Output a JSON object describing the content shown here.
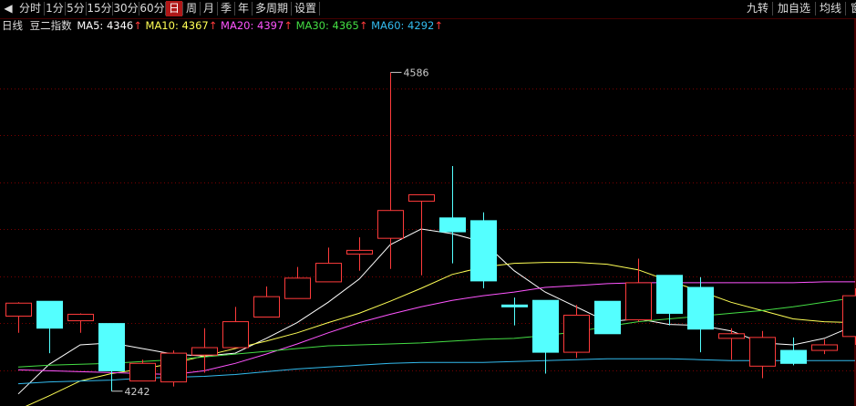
{
  "toolbar": {
    "left_items": [
      {
        "label": "分时",
        "active": false
      },
      {
        "label": "1分",
        "active": false
      },
      {
        "label": "5分",
        "active": false
      },
      {
        "label": "15分",
        "active": false
      },
      {
        "label": "30分",
        "active": false
      },
      {
        "label": "60分",
        "active": false
      },
      {
        "label": "日",
        "active": true
      },
      {
        "label": "周",
        "active": false
      },
      {
        "label": "月",
        "active": false
      },
      {
        "label": "季",
        "active": false
      },
      {
        "label": "年",
        "active": false
      },
      {
        "label": "多周期",
        "active": false
      },
      {
        "label": "设置",
        "active": false
      }
    ],
    "right_items": [
      "九转",
      "加自选",
      "均线",
      "窗"
    ]
  },
  "info": {
    "period": "日线",
    "name": "豆二指数",
    "ma5_label": "MA5: 4346",
    "ma10_label": "MA10: 4367",
    "ma20_label": "MA20: 4397",
    "ma30_label": "MA30: 4365",
    "ma60_label": "MA60: 4292",
    "arrow": "↑"
  },
  "colors": {
    "background": "#000000",
    "up": "#ff3b3b",
    "down": "#54ffff",
    "ma5": "#ffffff",
    "ma10": "#ffff55",
    "ma20": "#ff55ff",
    "ma30": "#44dd44",
    "ma60": "#33bbee",
    "grid": "#7a0000",
    "arrow": "#ff3b3b"
  },
  "chart_data": {
    "type": "candlestick",
    "title": "豆二指数",
    "price_range": [
      4226,
      4610
    ],
    "max_label": "4586",
    "min_label": "4242",
    "candles": [
      {
        "o": 4323,
        "h": 4338,
        "l": 4305,
        "c": 4337
      },
      {
        "o": 4339,
        "h": 4339,
        "l": 4283,
        "c": 4310
      },
      {
        "o": 4318,
        "h": 4326,
        "l": 4305,
        "c": 4325
      },
      {
        "o": 4315,
        "h": 4315,
        "l": 4242,
        "c": 4264
      },
      {
        "o": 4253,
        "h": 4276,
        "l": 4253,
        "c": 4272
      },
      {
        "o": 4252,
        "h": 4286,
        "l": 4247,
        "c": 4283
      },
      {
        "o": 4281,
        "h": 4310,
        "l": 4262,
        "c": 4289
      },
      {
        "o": 4289,
        "h": 4333,
        "l": 4289,
        "c": 4317
      },
      {
        "o": 4322,
        "h": 4355,
        "l": 4322,
        "c": 4344
      },
      {
        "o": 4342,
        "h": 4376,
        "l": 4342,
        "c": 4364
      },
      {
        "o": 4360,
        "h": 4397,
        "l": 4360,
        "c": 4380
      },
      {
        "o": 4390,
        "h": 4408,
        "l": 4372,
        "c": 4394
      },
      {
        "o": 4407,
        "h": 4586,
        "l": 4374,
        "c": 4437
      },
      {
        "o": 4447,
        "h": 4447,
        "l": 4367,
        "c": 4454
      },
      {
        "o": 4429,
        "h": 4485,
        "l": 4380,
        "c": 4414
      },
      {
        "o": 4426,
        "h": 4435,
        "l": 4353,
        "c": 4361
      },
      {
        "o": 4335,
        "h": 4343,
        "l": 4313,
        "c": 4333
      },
      {
        "o": 4340,
        "h": 4340,
        "l": 4261,
        "c": 4284
      },
      {
        "o": 4284,
        "h": 4335,
        "l": 4278,
        "c": 4324
      },
      {
        "o": 4339,
        "h": 4339,
        "l": 4304,
        "c": 4304
      },
      {
        "o": 4319,
        "h": 4385,
        "l": 4317,
        "c": 4359
      },
      {
        "o": 4367,
        "h": 4367,
        "l": 4313,
        "c": 4326
      },
      {
        "o": 4354,
        "h": 4365,
        "l": 4284,
        "c": 4309
      },
      {
        "o": 4299,
        "h": 4310,
        "l": 4276,
        "c": 4304
      },
      {
        "o": 4269,
        "h": 4307,
        "l": 4256,
        "c": 4300
      },
      {
        "o": 4286,
        "h": 4300,
        "l": 4270,
        "c": 4272
      },
      {
        "o": 4286,
        "h": 4298,
        "l": 4282,
        "c": 4292
      },
      {
        "o": 4301,
        "h": 4353,
        "l": 4292,
        "c": 4345
      }
    ],
    "ma_series": [
      {
        "name": "MA5",
        "values": [
          4239,
          4271,
          4292,
          4294,
          4288,
          4282,
          4280,
          4283,
          4299,
          4316,
          4338,
          4363,
          4400,
          4417,
          4412,
          4403,
          4372,
          4349,
          4333,
          4317,
          4320,
          4314,
          4313,
          4307,
          4294,
          4292,
          4299,
          4313
        ]
      },
      {
        "name": "MA10",
        "values": [
          4222,
          4237,
          4253,
          4261,
          4266,
          4272,
          4280,
          4288,
          4296,
          4305,
          4316,
          4326,
          4339,
          4353,
          4368,
          4376,
          4380,
          4381,
          4381,
          4379,
          4373,
          4361,
          4350,
          4338,
          4329,
          4320,
          4317,
          4316
        ]
      },
      {
        "name": "MA20",
        "values": [
          4265,
          4264,
          4263,
          4262,
          4261,
          4260,
          4264,
          4272,
          4282,
          4293,
          4305,
          4316,
          4325,
          4333,
          4340,
          4345,
          4349,
          4354,
          4356,
          4358,
          4359,
          4359,
          4359,
          4359,
          4359,
          4359,
          4360,
          4360
        ]
      },
      {
        "name": "MA30",
        "values": [
          4268,
          4270,
          4271,
          4272,
          4274,
          4276,
          4279,
          4282,
          4285,
          4288,
          4291,
          4292,
          4293,
          4294,
          4296,
          4298,
          4299,
          4302,
          4306,
          4312,
          4317,
          4320,
          4323,
          4326,
          4329,
          4333,
          4338,
          4343
        ]
      },
      {
        "name": "MA60",
        "values": [
          4250,
          4252,
          4253,
          4254,
          4256,
          4257,
          4258,
          4260,
          4263,
          4266,
          4268,
          4270,
          4272,
          4273,
          4273,
          4273,
          4274,
          4275,
          4276,
          4277,
          4277,
          4277,
          4276,
          4275,
          4275,
          4275,
          4275,
          4275
        ]
      }
    ]
  }
}
